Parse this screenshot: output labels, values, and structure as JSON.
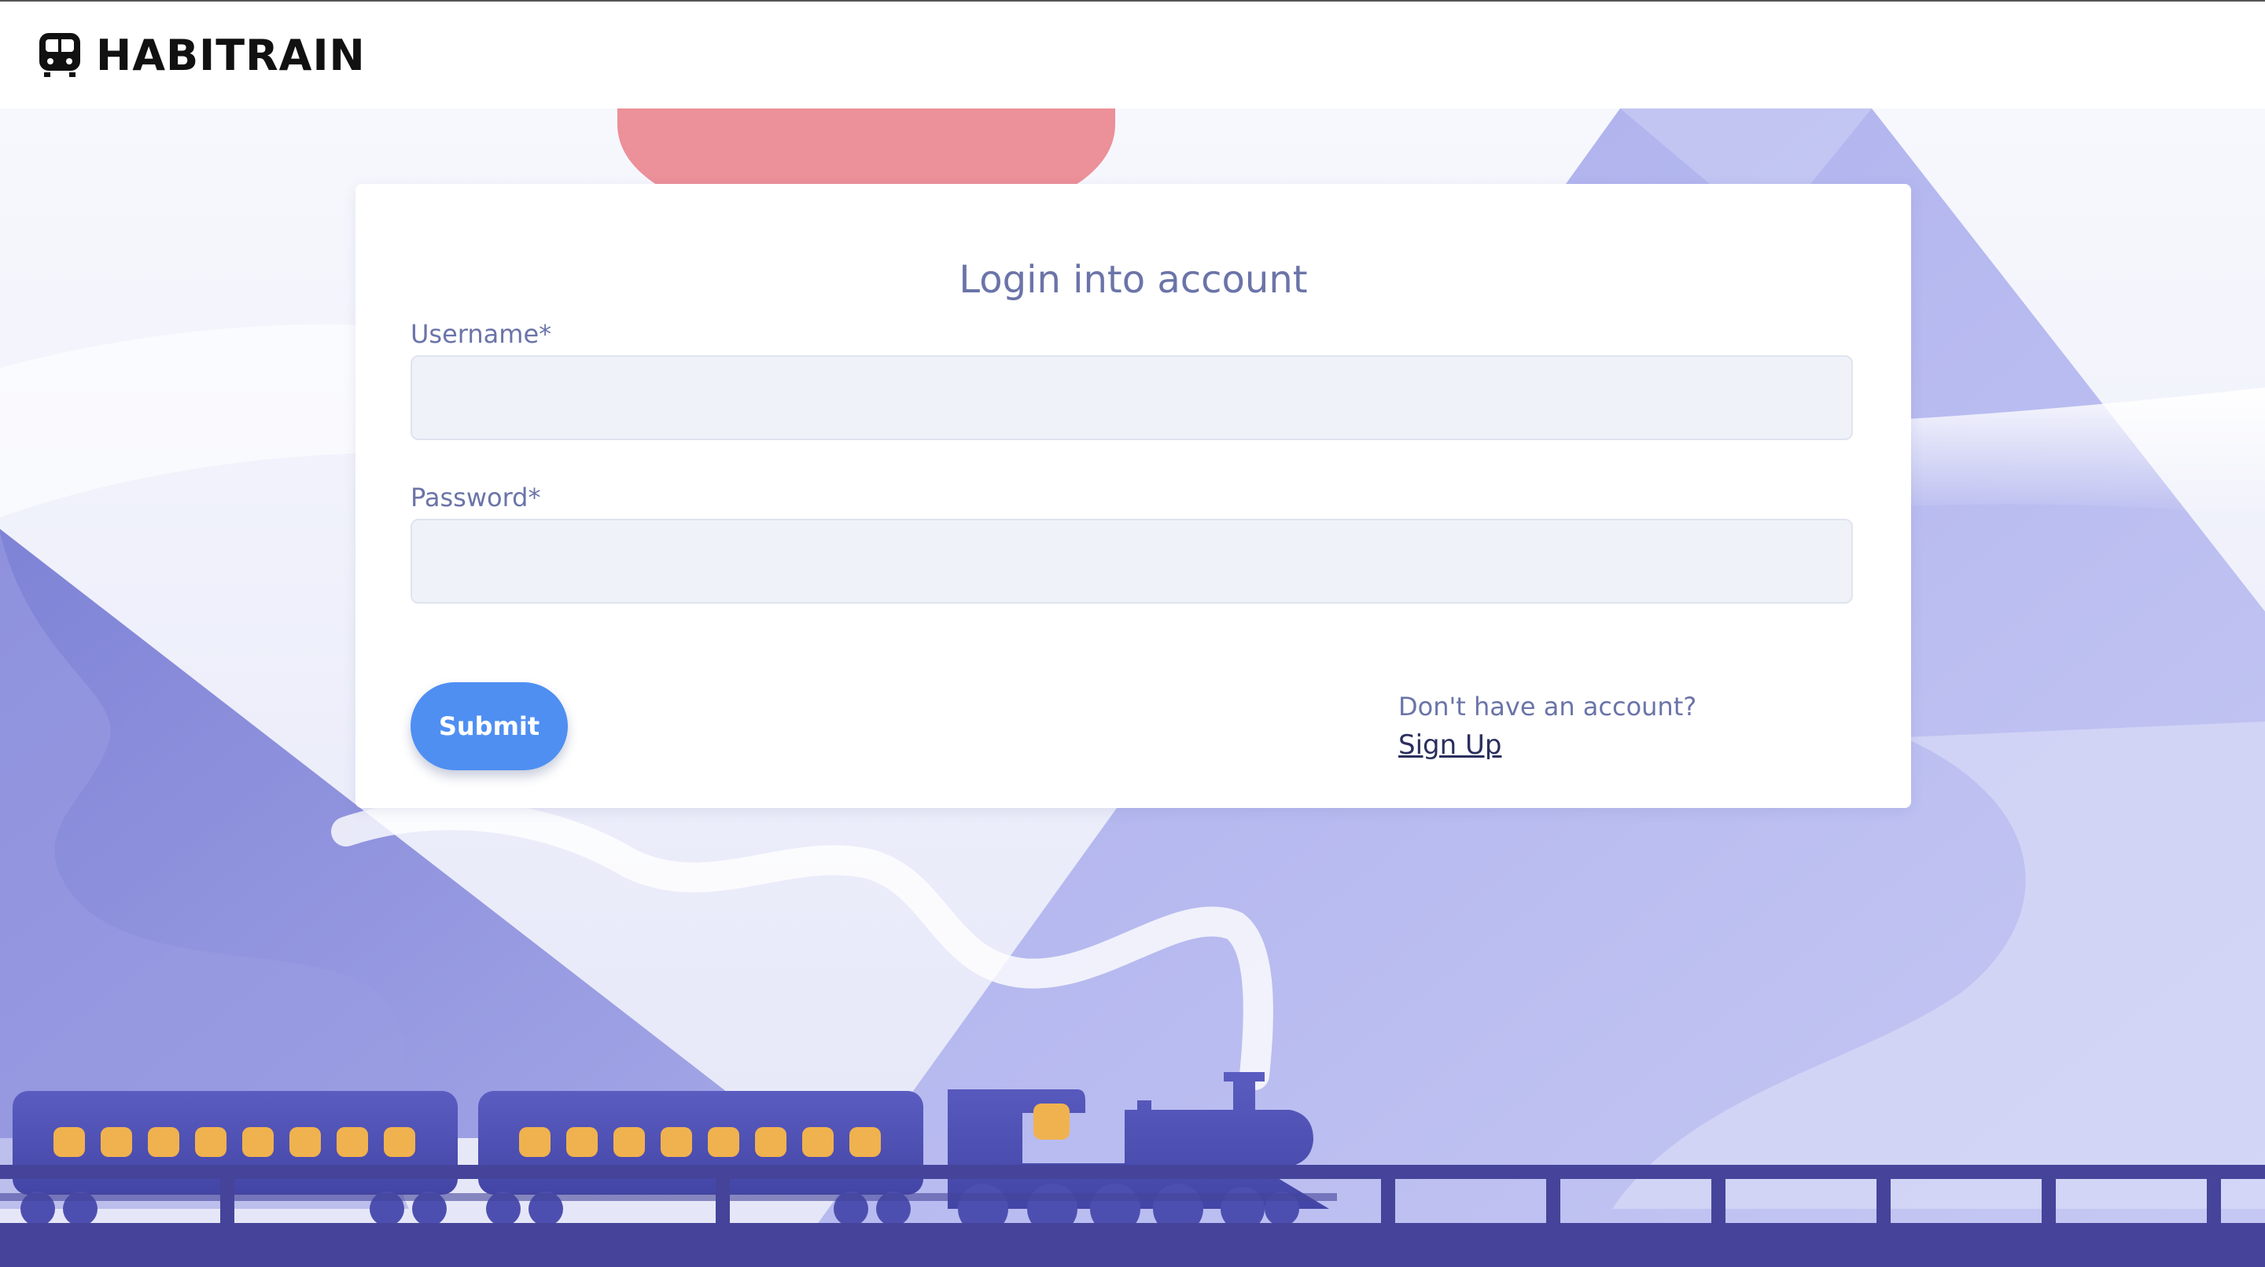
{
  "app": {
    "brand_name": "HABITRAIN",
    "brand_icon": "train-icon"
  },
  "login": {
    "title": "Login into account",
    "username_label": "Username*",
    "username_value": "",
    "password_label": "Password*",
    "password_value": "",
    "submit_label": "Submit",
    "signup_prompt": "Don't have an account?",
    "signup_link": "Sign Up"
  },
  "colors": {
    "accent": "#4f8ff2",
    "label_text": "#6b74a8",
    "mountain": "#8f93dc",
    "sun": "#ec9099",
    "train": "#4d4fb0",
    "window_light": "#f0b24f",
    "track": "#45449a"
  }
}
